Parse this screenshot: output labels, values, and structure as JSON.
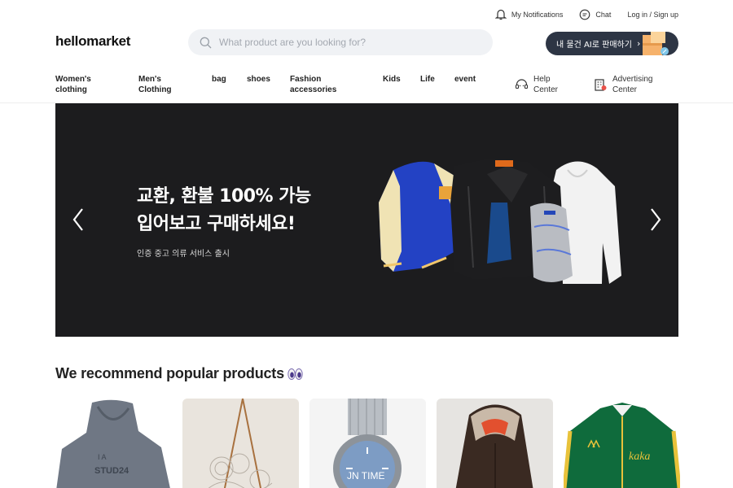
{
  "utility_bar": {
    "notifications_label": "My Notifications",
    "chat_label": "Chat",
    "login_label": "Log in / Sign up"
  },
  "header": {
    "logo": "hellomarket",
    "search_placeholder": "What product are you looking for?",
    "sell_button_label": "내 물건 AI로 판매하기",
    "sell_button_chevron": "›"
  },
  "nav": {
    "items": [
      {
        "label": "Women's\nclothing"
      },
      {
        "label": "Men's\nClothing"
      },
      {
        "label": "bag"
      },
      {
        "label": "shoes"
      },
      {
        "label": "Fashion\naccessories"
      },
      {
        "label": "Kids"
      },
      {
        "label": "Life"
      },
      {
        "label": "event"
      }
    ],
    "help_center": "Help\nCenter",
    "advertising_center": "Advertising\nCenter"
  },
  "banner": {
    "title_line1": "교환, 환불 100% 가능",
    "title_line2": "입어보고 구매하세요!",
    "subtitle": "인증 중고 의류 서비스 출시"
  },
  "recommend": {
    "title": "We recommend popular products",
    "products": [
      {
        "name": "gray hoodie"
      },
      {
        "name": "wire hanger stand"
      },
      {
        "name": "wristwatch",
        "overlay_text": "JN TIME"
      },
      {
        "name": "fur hood jacket"
      },
      {
        "name": "green track jacket"
      }
    ]
  },
  "colors": {
    "banner_bg": "#1c1c1e",
    "sell_button_bg": "#2d3544",
    "search_bg": "#f0f2f5"
  },
  "icons": [
    "bell-icon",
    "chat-icon",
    "search-icon",
    "chevron-right-icon",
    "headset-icon",
    "building-icon",
    "arrow-left-icon",
    "arrow-right-icon",
    "eyes-icon"
  ]
}
